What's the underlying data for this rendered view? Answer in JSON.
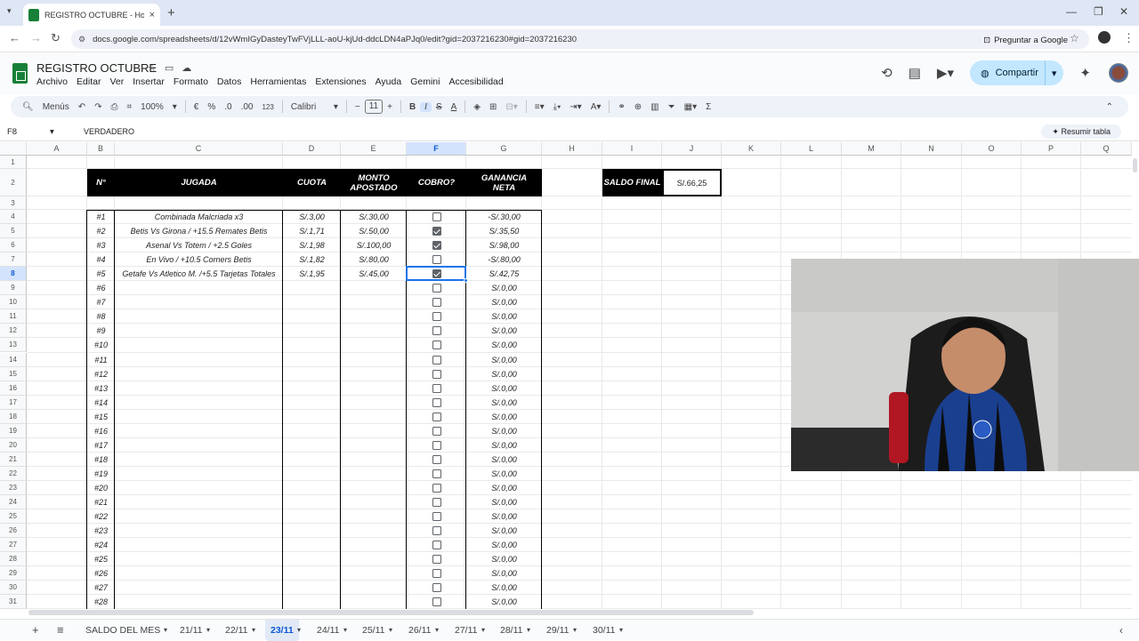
{
  "browser": {
    "tab_title": "REGISTRO OCTUBRE - Hojas de",
    "tab_close": "×",
    "new_tab": "+",
    "url": "docs.google.com/spreadsheets/d/12vWmIGyDasteyTwFVjLLL-aoU-kjUd-ddcLDN4aPJq0/edit?gid=2037216230#gid=2037216230",
    "ask_google": "Preguntar a Google"
  },
  "app": {
    "doc_title": "REGISTRO OCTUBRE",
    "menu": [
      "Archivo",
      "Editar",
      "Ver",
      "Insertar",
      "Formato",
      "Datos",
      "Herramientas",
      "Extensiones",
      "Ayuda",
      "Gemini",
      "Accesibilidad"
    ],
    "share_label": "Compartir"
  },
  "toolbar": {
    "menus": "Menús",
    "zoom": "100%",
    "currency": "€",
    "percent": "%",
    "dec_less": ".0",
    "dec_more": ".00",
    "number_fmt": "123",
    "font": "Calibri",
    "font_size": "11",
    "minus": "−",
    "plus": "+",
    "bold": "B",
    "italic": "I",
    "strike": "S",
    "underline_a": "A",
    "sigma": "Σ"
  },
  "formula": {
    "cell_ref": "F8",
    "value": "VERDADERO",
    "resumir": "Resumir tabla"
  },
  "columns": [
    "A",
    "B",
    "C",
    "D",
    "E",
    "F",
    "G",
    "H",
    "I",
    "J",
    "K",
    "L",
    "M",
    "N",
    "O",
    "P",
    "Q"
  ],
  "rows": [
    "1",
    "2",
    "3",
    "4",
    "5",
    "6",
    "7",
    "8",
    "9",
    "10",
    "11",
    "12",
    "13",
    "14",
    "15",
    "16",
    "17",
    "18",
    "19",
    "20",
    "21",
    "22",
    "23",
    "24",
    "25",
    "26",
    "27",
    "28",
    "29",
    "30",
    "31"
  ],
  "table": {
    "headers": [
      "N°",
      "JUGADA",
      "CUOTA",
      "MONTO APOSTADO",
      "COBRO?",
      "GANANCIA NETA"
    ],
    "rows": [
      {
        "n": "#1",
        "jugada": "Combinada Malcriada x3",
        "cuota": "S/.3,00",
        "monto": "S/.30,00",
        "cobro": false,
        "ganancia": "-S/.30,00"
      },
      {
        "n": "#2",
        "jugada": "Betis Vs Girona / +15.5 Remates Betis",
        "cuota": "S/.1,71",
        "monto": "S/.50,00",
        "cobro": true,
        "ganancia": "S/.35,50"
      },
      {
        "n": "#3",
        "jugada": "Asenal Vs Totem / +2.5 Goles",
        "cuota": "S/.1,98",
        "monto": "S/.100,00",
        "cobro": true,
        "ganancia": "S/.98,00"
      },
      {
        "n": "#4",
        "jugada": "En Vivo / +10.5 Corners Betis",
        "cuota": "S/.1,82",
        "monto": "S/.80,00",
        "cobro": false,
        "ganancia": "-S/.80,00"
      },
      {
        "n": "#5",
        "jugada": "Getafe Vs Atletico M. /+5.5 Tarjetas Totales",
        "cuota": "S/.1,95",
        "monto": "S/.45,00",
        "cobro": true,
        "ganancia": "S/.42,75"
      },
      {
        "n": "#6",
        "jugada": "",
        "cuota": "",
        "monto": "",
        "cobro": false,
        "ganancia": "S/.0,00"
      },
      {
        "n": "#7",
        "jugada": "",
        "cuota": "",
        "monto": "",
        "cobro": false,
        "ganancia": "S/.0,00"
      },
      {
        "n": "#8",
        "jugada": "",
        "cuota": "",
        "monto": "",
        "cobro": false,
        "ganancia": "S/.0,00"
      },
      {
        "n": "#9",
        "jugada": "",
        "cuota": "",
        "monto": "",
        "cobro": false,
        "ganancia": "S/.0,00"
      },
      {
        "n": "#10",
        "jugada": "",
        "cuota": "",
        "monto": "",
        "cobro": false,
        "ganancia": "S/.0,00"
      },
      {
        "n": "#11",
        "jugada": "",
        "cuota": "",
        "monto": "",
        "cobro": false,
        "ganancia": "S/.0,00"
      },
      {
        "n": "#12",
        "jugada": "",
        "cuota": "",
        "monto": "",
        "cobro": false,
        "ganancia": "S/.0,00"
      },
      {
        "n": "#13",
        "jugada": "",
        "cuota": "",
        "monto": "",
        "cobro": false,
        "ganancia": "S/.0,00"
      },
      {
        "n": "#14",
        "jugada": "",
        "cuota": "",
        "monto": "",
        "cobro": false,
        "ganancia": "S/.0,00"
      },
      {
        "n": "#15",
        "jugada": "",
        "cuota": "",
        "monto": "",
        "cobro": false,
        "ganancia": "S/.0,00"
      },
      {
        "n": "#16",
        "jugada": "",
        "cuota": "",
        "monto": "",
        "cobro": false,
        "ganancia": "S/.0,00"
      },
      {
        "n": "#17",
        "jugada": "",
        "cuota": "",
        "monto": "",
        "cobro": false,
        "ganancia": "S/.0,00"
      },
      {
        "n": "#18",
        "jugada": "",
        "cuota": "",
        "monto": "",
        "cobro": false,
        "ganancia": "S/.0,00"
      },
      {
        "n": "#19",
        "jugada": "",
        "cuota": "",
        "monto": "",
        "cobro": false,
        "ganancia": "S/.0,00"
      },
      {
        "n": "#20",
        "jugada": "",
        "cuota": "",
        "monto": "",
        "cobro": false,
        "ganancia": "S/.0,00"
      },
      {
        "n": "#21",
        "jugada": "",
        "cuota": "",
        "monto": "",
        "cobro": false,
        "ganancia": "S/.0,00"
      },
      {
        "n": "#22",
        "jugada": "",
        "cuota": "",
        "monto": "",
        "cobro": false,
        "ganancia": "S/.0,00"
      },
      {
        "n": "#23",
        "jugada": "",
        "cuota": "",
        "monto": "",
        "cobro": false,
        "ganancia": "S/.0,00"
      },
      {
        "n": "#24",
        "jugada": "",
        "cuota": "",
        "monto": "",
        "cobro": false,
        "ganancia": "S/.0,00"
      },
      {
        "n": "#25",
        "jugada": "",
        "cuota": "",
        "monto": "",
        "cobro": false,
        "ganancia": "S/.0,00"
      },
      {
        "n": "#26",
        "jugada": "",
        "cuota": "",
        "monto": "",
        "cobro": false,
        "ganancia": "S/.0,00"
      },
      {
        "n": "#27",
        "jugada": "",
        "cuota": "",
        "monto": "",
        "cobro": false,
        "ganancia": "S/.0,00"
      },
      {
        "n": "#28",
        "jugada": "",
        "cuota": "",
        "monto": "",
        "cobro": false,
        "ganancia": "S/.0,00"
      }
    ]
  },
  "saldo": {
    "label": "SALDO FINAL",
    "value": "S/.66,25"
  },
  "sheets": [
    "SALDO DEL MES",
    "21/11",
    "22/11",
    "23/11",
    "24/11",
    "25/11",
    "26/11",
    "27/11",
    "28/11",
    "29/11",
    "30/11"
  ],
  "active_sheet": "23/11",
  "colors": {
    "accent": "#1a73e8",
    "share_bg": "#c2e7ff",
    "header_bg": "#000000",
    "sheets_green": "#188038"
  }
}
